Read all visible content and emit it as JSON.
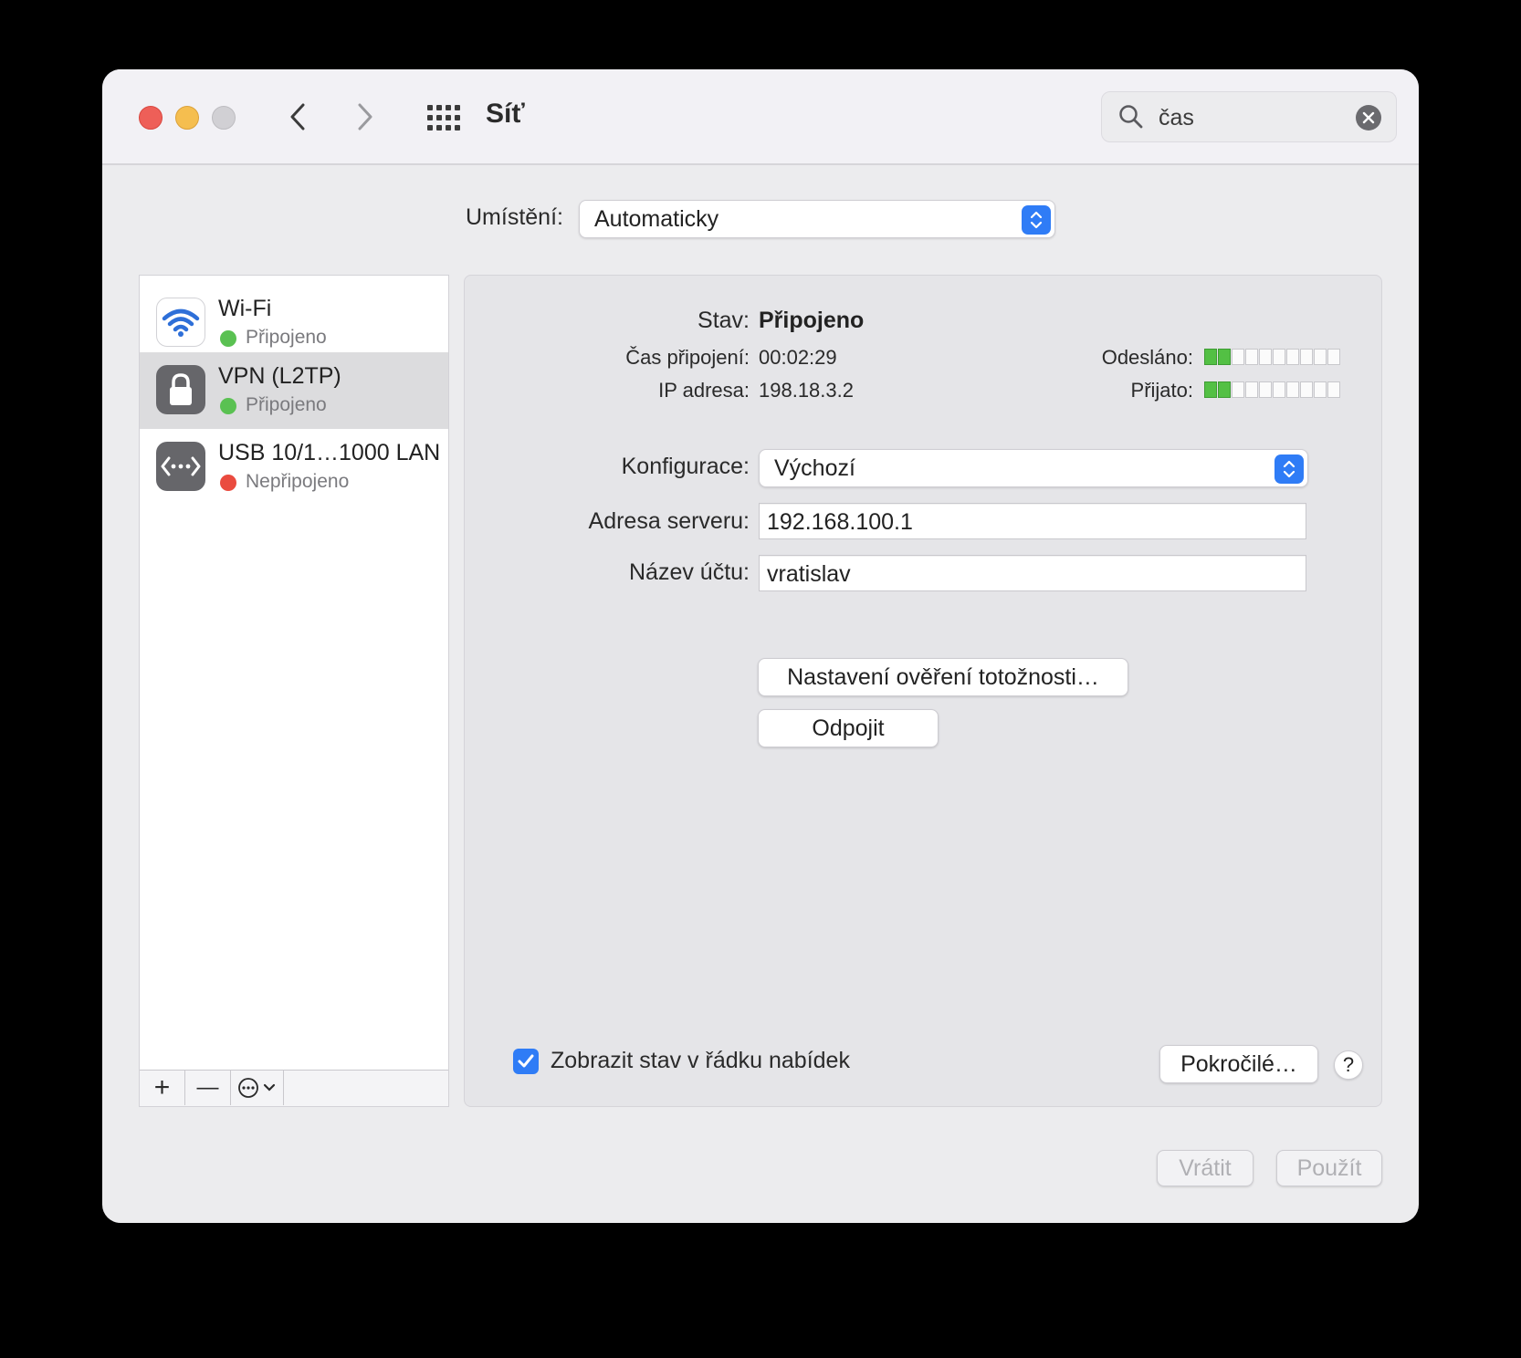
{
  "window": {
    "title": "Síť",
    "search": {
      "value": "čas"
    }
  },
  "location": {
    "label": "Umístění:",
    "value": "Automaticky"
  },
  "services": [
    {
      "name": "Wi-Fi",
      "status": "Připojeno",
      "status_color": "#5ac152"
    },
    {
      "name": "VPN (L2TP)",
      "status": "Připojeno",
      "status_color": "#5ac152"
    },
    {
      "name": "USB 10/1…1000 LAN",
      "status": "Nepřipojeno",
      "status_color": "#ea4b3f"
    }
  ],
  "sidebar_toolbar": {
    "add": "+",
    "remove": "—"
  },
  "detail": {
    "status_label": "Stav:",
    "status_value": "Připojeno",
    "connect_time_label": "Čas připojení:",
    "connect_time_value": "00:02:29",
    "ip_label": "IP adresa:",
    "ip_value": "198.18.3.2",
    "sent_label": "Odesláno:",
    "sent_level": 2,
    "received_label": "Přijato:",
    "received_level": 2,
    "meter_segments": 10,
    "config_label": "Konfigurace:",
    "config_value": "Výchozí",
    "server_label": "Adresa serveru:",
    "server_value": "192.168.100.1",
    "account_label": "Název účtu:",
    "account_value": "vratislav",
    "auth_button": "Nastavení ověření totožnosti…",
    "disconnect_button": "Odpojit",
    "show_status_label": "Zobrazit stav v řádku nabídek",
    "show_status_checked": true,
    "advanced_button": "Pokročilé…",
    "help_button": "?"
  },
  "footer": {
    "revert_button": "Vrátit",
    "apply_button": "Použít"
  },
  "colors": {
    "accent": "#2f7cf6",
    "connected": "#5ac152",
    "disconnected": "#ea4b3f"
  }
}
